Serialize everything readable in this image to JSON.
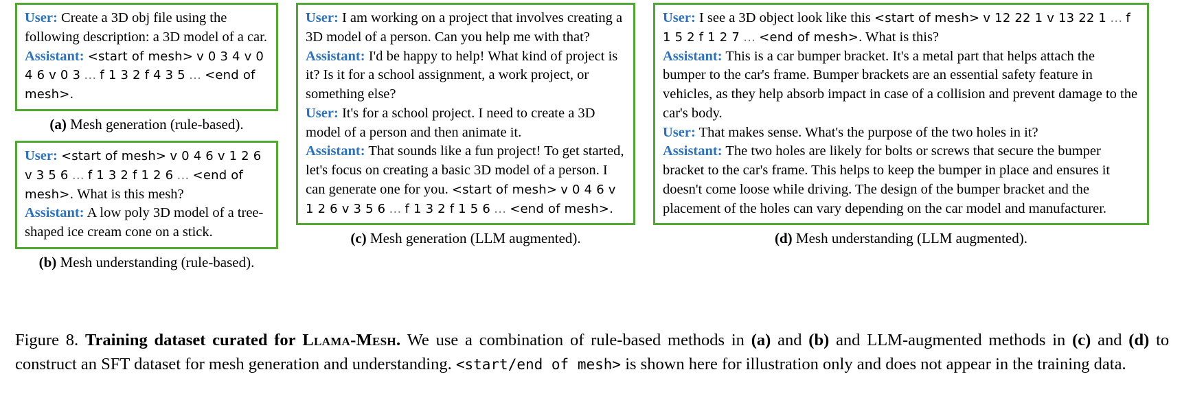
{
  "figure": {
    "number": "Figure 8.",
    "title": "Training dataset curated for",
    "model_name": "Llama-Mesh.",
    "caption_part1": "We use a combination of rule-based methods in",
    "ref_a": "(a)",
    "and1": "and",
    "ref_b": "(b)",
    "caption_part2": "and LLM-augmented methods in",
    "ref_c": "(c)",
    "and2": "and",
    "ref_d": "(d)",
    "caption_part3": "to construct an SFT dataset for mesh generation and understanding.",
    "mono_token": "<start/end of mesh>",
    "caption_part4": "is shown here for illustration only and does not appear in the training data."
  },
  "colors": {
    "box_border": "#4fa832",
    "role_label": "#2a72c0",
    "text": "#000000",
    "ellipsis": "#777777"
  },
  "roles": {
    "user": "User:",
    "assistant": "Assistant:"
  },
  "panels": {
    "a": {
      "label": "(a)",
      "caption": "Mesh generation (rule-based).",
      "turns": [
        {
          "role": "User:",
          "segments": [
            {
              "type": "text",
              "value": "Create a 3D obj file using the following description: a 3D model of a car."
            }
          ]
        },
        {
          "role": "Assistant:",
          "segments": [
            {
              "type": "mesh",
              "value": "<start of mesh>"
            },
            {
              "type": "mesh",
              "value": "v 0 3 4 v 0 4 6 v 0 3"
            },
            {
              "type": "ellipsis",
              "value": "…"
            },
            {
              "type": "mesh",
              "value": "f 1 3 2 f 4 3 5"
            },
            {
              "type": "ellipsis",
              "value": "…"
            },
            {
              "type": "mesh",
              "value": "<end of mesh>."
            }
          ]
        }
      ]
    },
    "b": {
      "label": "(b)",
      "caption": "Mesh understanding (rule-based).",
      "turns": [
        {
          "role": "User:",
          "segments": [
            {
              "type": "mesh",
              "value": "<start of mesh>"
            },
            {
              "type": "mesh",
              "value": "v 0 4 6 v 1 2 6 v 3 5 6"
            },
            {
              "type": "ellipsis",
              "value": "…"
            },
            {
              "type": "mesh",
              "value": "f 1 3 2 f 1 2 6"
            },
            {
              "type": "ellipsis",
              "value": "…"
            },
            {
              "type": "mesh",
              "value": "<end of mesh>."
            },
            {
              "type": "text",
              "value": " What is this mesh?"
            }
          ]
        },
        {
          "role": "Assistant:",
          "segments": [
            {
              "type": "text",
              "value": "A low poly 3D model of a tree-shaped ice cream cone on a stick."
            }
          ]
        }
      ]
    },
    "c": {
      "label": "(c)",
      "caption": "Mesh generation (LLM augmented).",
      "turns": [
        {
          "role": "User:",
          "segments": [
            {
              "type": "text",
              "value": "I am working on a project that involves creating a 3D model of a person. Can you help me with that?"
            }
          ]
        },
        {
          "role": "Assistant:",
          "segments": [
            {
              "type": "text",
              "value": "I'd be happy to help! What kind of project is it? Is it for a school assignment, a work project, or something else?"
            }
          ]
        },
        {
          "role": "User:",
          "segments": [
            {
              "type": "text",
              "value": "It's for a school project. I need to create a 3D model of a person and then animate it."
            }
          ]
        },
        {
          "role": "Assistant:",
          "segments": [
            {
              "type": "text",
              "value": "That sounds like a fun project! To get started, let's focus on creating a basic 3D model of a person. I can generate one for you. "
            },
            {
              "type": "mesh",
              "value": "<start of mesh>"
            },
            {
              "type": "mesh",
              "value": "v 0 4 6 v 1 2 6 v 3 5 6"
            },
            {
              "type": "ellipsis",
              "value": "…"
            },
            {
              "type": "mesh",
              "value": "f 1 3 2 f 1 5 6"
            },
            {
              "type": "ellipsis",
              "value": "…"
            },
            {
              "type": "mesh",
              "value": "<end of mesh>."
            }
          ]
        }
      ]
    },
    "d": {
      "label": "(d)",
      "caption": "Mesh understanding (LLM augmented).",
      "turns": [
        {
          "role": "User:",
          "segments": [
            {
              "type": "text",
              "value": "I see a 3D object look like this "
            },
            {
              "type": "mesh",
              "value": "<start of mesh>"
            },
            {
              "type": "mesh",
              "value": "v 12 22 1 v 13 22 1"
            },
            {
              "type": "ellipsis",
              "value": "…"
            },
            {
              "type": "mesh",
              "value": "f 1 5 2 f 1 2 7"
            },
            {
              "type": "ellipsis",
              "value": "…"
            },
            {
              "type": "mesh",
              "value": "<end of mesh>"
            },
            {
              "type": "text",
              "value": ". What is this?"
            }
          ]
        },
        {
          "role": "Assistant:",
          "segments": [
            {
              "type": "text",
              "value": "This is a car bumper bracket. It's a metal part that helps attach the bumper to the car's frame. Bumper brackets are an essential safety feature in vehicles, as they help absorb impact in case of a collision and prevent damage to the car's body."
            }
          ]
        },
        {
          "role": "User:",
          "segments": [
            {
              "type": "text",
              "value": "That makes sense. What's the purpose of the two holes in it?"
            }
          ]
        },
        {
          "role": "Assistant:",
          "segments": [
            {
              "type": "text",
              "value": "The two holes are likely for bolts or screws that secure the bumper bracket to the car's frame. This helps to keep the bumper in place and ensures it doesn't come loose while driving. The design of the bumper bracket and the placement of the holes can vary depending on the car model and manufacturer."
            }
          ]
        }
      ]
    }
  }
}
